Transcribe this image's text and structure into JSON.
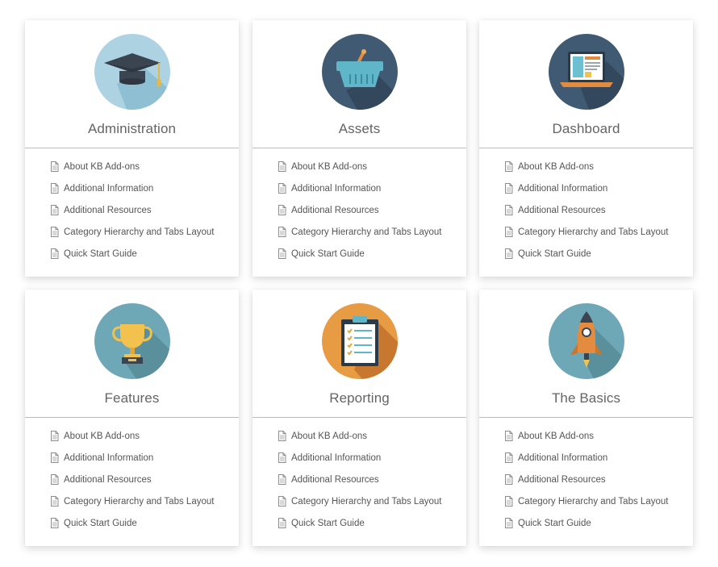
{
  "categories": [
    {
      "title": "Administration",
      "icon": "graduation-cap-icon",
      "icon_bg": "#add3e3",
      "links": [
        "About KB Add-ons",
        "Additional Information",
        "Additional Resources",
        "Category Hierarchy and Tabs Layout",
        "Quick Start Guide"
      ]
    },
    {
      "title": "Assets",
      "icon": "basket-icon",
      "icon_bg": "#3f5a72",
      "links": [
        "About KB Add-ons",
        "Additional Information",
        "Additional Resources",
        "Category Hierarchy and Tabs Layout",
        "Quick Start Guide"
      ]
    },
    {
      "title": "Dashboard",
      "icon": "laptop-icon",
      "icon_bg": "#3f5a72",
      "links": [
        "About KB Add-ons",
        "Additional Information",
        "Additional Resources",
        "Category Hierarchy and Tabs Layout",
        "Quick Start Guide"
      ]
    },
    {
      "title": "Features",
      "icon": "trophy-icon",
      "icon_bg": "#6ea7b5",
      "links": [
        "About KB Add-ons",
        "Additional Information",
        "Additional Resources",
        "Category Hierarchy and Tabs Layout",
        "Quick Start Guide"
      ]
    },
    {
      "title": "Reporting",
      "icon": "clipboard-icon",
      "icon_bg": "#e79b43",
      "links": [
        "About KB Add-ons",
        "Additional Information",
        "Additional Resources",
        "Category Hierarchy and Tabs Layout",
        "Quick Start Guide"
      ]
    },
    {
      "title": "The Basics",
      "icon": "rocket-icon",
      "icon_bg": "#6ea7b5",
      "links": [
        "About KB Add-ons",
        "Additional Information",
        "Additional Resources",
        "Category Hierarchy and Tabs Layout",
        "Quick Start Guide"
      ]
    }
  ]
}
